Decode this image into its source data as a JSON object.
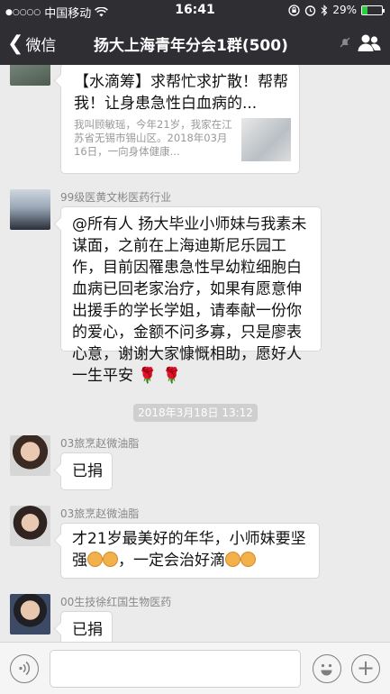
{
  "status_bar": {
    "carrier": "中国移动",
    "time": "16:41",
    "battery": "29%",
    "battery_level": 0.29
  },
  "nav": {
    "back_label": "微信",
    "title": "扬大上海青年分会1群(500)"
  },
  "messages": [
    {
      "type": "link_card",
      "title": "【水滴筹】求帮忙求扩散！帮帮我！让身患急性白血病的...",
      "description": "我叫顾敏瑶，今年21岁，我家在江苏省无锡市锡山区。2018年03月16日，一向身体健康..."
    },
    {
      "type": "text",
      "sender": "99级医黄文彬医药行业",
      "text": "@所有人 扬大毕业小师妹与我素未谋面，之前在上海迪斯尼乐园工作，目前因罹患急性早幼粒细胞白血病已回老家治疗，如果有愿意伸出援手的学长学姐，请奉献一份你的爱心，金额不问多寡，只是廖表心意，谢谢大家慷慨相助，愿好人一生平安",
      "emoji": "🌹 🌹"
    },
    {
      "type": "time",
      "text": "2018年3月18日 13:12"
    },
    {
      "type": "text",
      "sender": "03旅烹赵微油脂",
      "text": "已捐"
    },
    {
      "type": "text",
      "sender": "03旅烹赵微油脂",
      "text_a": "才21岁最美好的年华，小师妹要坚强",
      "text_b": "，一定会治好滴"
    },
    {
      "type": "text",
      "sender": "00生技徐红国生物医药",
      "text": "已捐"
    }
  ],
  "icons": [
    "signal-dots-icon",
    "wifi-icon",
    "lock-rotation-icon",
    "alarm-icon",
    "bluetooth-icon",
    "battery-icon",
    "back-chevron-icon",
    "mute-icon",
    "group-members-icon",
    "voice-icon",
    "emoji-icon",
    "plus-icon",
    "rose-emoji-icon",
    "fist-emoji-icon"
  ],
  "colors": {
    "nav_background": "#2e2e33",
    "chat_background": "#ebebeb",
    "bubble": "#ffffff",
    "battery_fill": "#2ecc40"
  }
}
